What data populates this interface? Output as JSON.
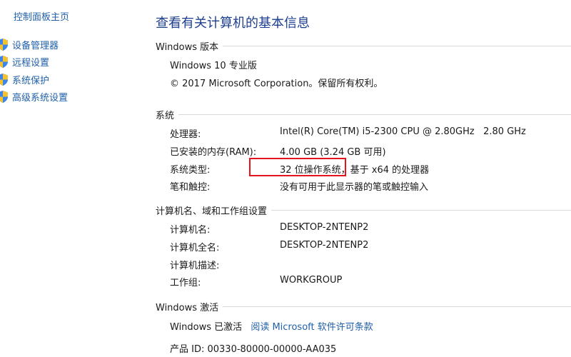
{
  "nav": {
    "home": "控制面板主页",
    "items": [
      {
        "label": "设备管理器",
        "icon": "shield-icon"
      },
      {
        "label": "远程设置",
        "icon": "shield-icon"
      },
      {
        "label": "系统保护",
        "icon": "shield-icon"
      },
      {
        "label": "高级系统设置",
        "icon": "shield-icon"
      }
    ]
  },
  "title": "查看有关计算机的基本信息",
  "windows_edition": {
    "heading": "Windows 版本",
    "edition": "Windows 10 专业版",
    "copyright": "© 2017 Microsoft Corporation。保留所有权利。"
  },
  "system": {
    "heading": "系统",
    "rows": [
      {
        "label": "处理器:",
        "value": "Intel(R) Core(TM) i5-2300 CPU @ 2.80GHz   2.80 GHz"
      },
      {
        "label": "已安装的内存(RAM):",
        "value": "4.00 GB (3.24 GB 可用)"
      },
      {
        "label": "系统类型:",
        "value": "32 位操作系统，基于 x64 的处理器"
      },
      {
        "label": "笔和触控:",
        "value": "没有可用于此显示器的笔或触控输入"
      }
    ]
  },
  "computer": {
    "heading": "计算机名、域和工作组设置",
    "rows": [
      {
        "label": "计算机名:",
        "value": "DESKTOP-2NTENP2"
      },
      {
        "label": "计算机全名:",
        "value": "DESKTOP-2NTENP2"
      },
      {
        "label": "计算机描述:",
        "value": ""
      },
      {
        "label": "工作组:",
        "value": "WORKGROUP"
      }
    ]
  },
  "activation": {
    "heading": "Windows 激活",
    "status": "Windows 已激活",
    "license_link": "阅读 Microsoft 软件许可条款",
    "product_id": "产品 ID: 00330-80000-00000-AA035"
  },
  "colors": {
    "link": "#1f5fa8",
    "title": "#1e3f8f",
    "highlight": "#e5141b"
  }
}
